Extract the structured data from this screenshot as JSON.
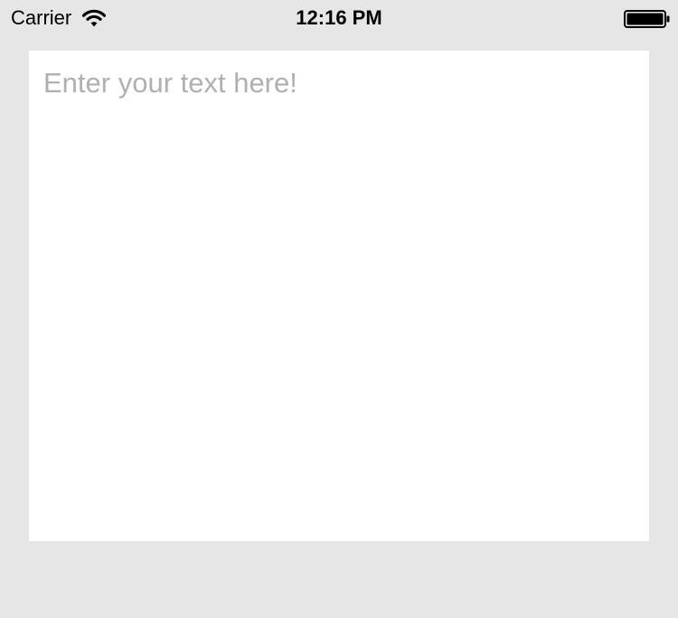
{
  "status_bar": {
    "carrier": "Carrier",
    "time": "12:16 PM",
    "icons": [
      "wifi-icon",
      "battery-icon"
    ]
  },
  "text_view": {
    "value": "",
    "placeholder": "Enter your text here!"
  },
  "colors": {
    "background": "#e6e6e6",
    "text_view_background": "#ffffff",
    "placeholder": "#b0b0b0",
    "status_text": "#000000"
  }
}
